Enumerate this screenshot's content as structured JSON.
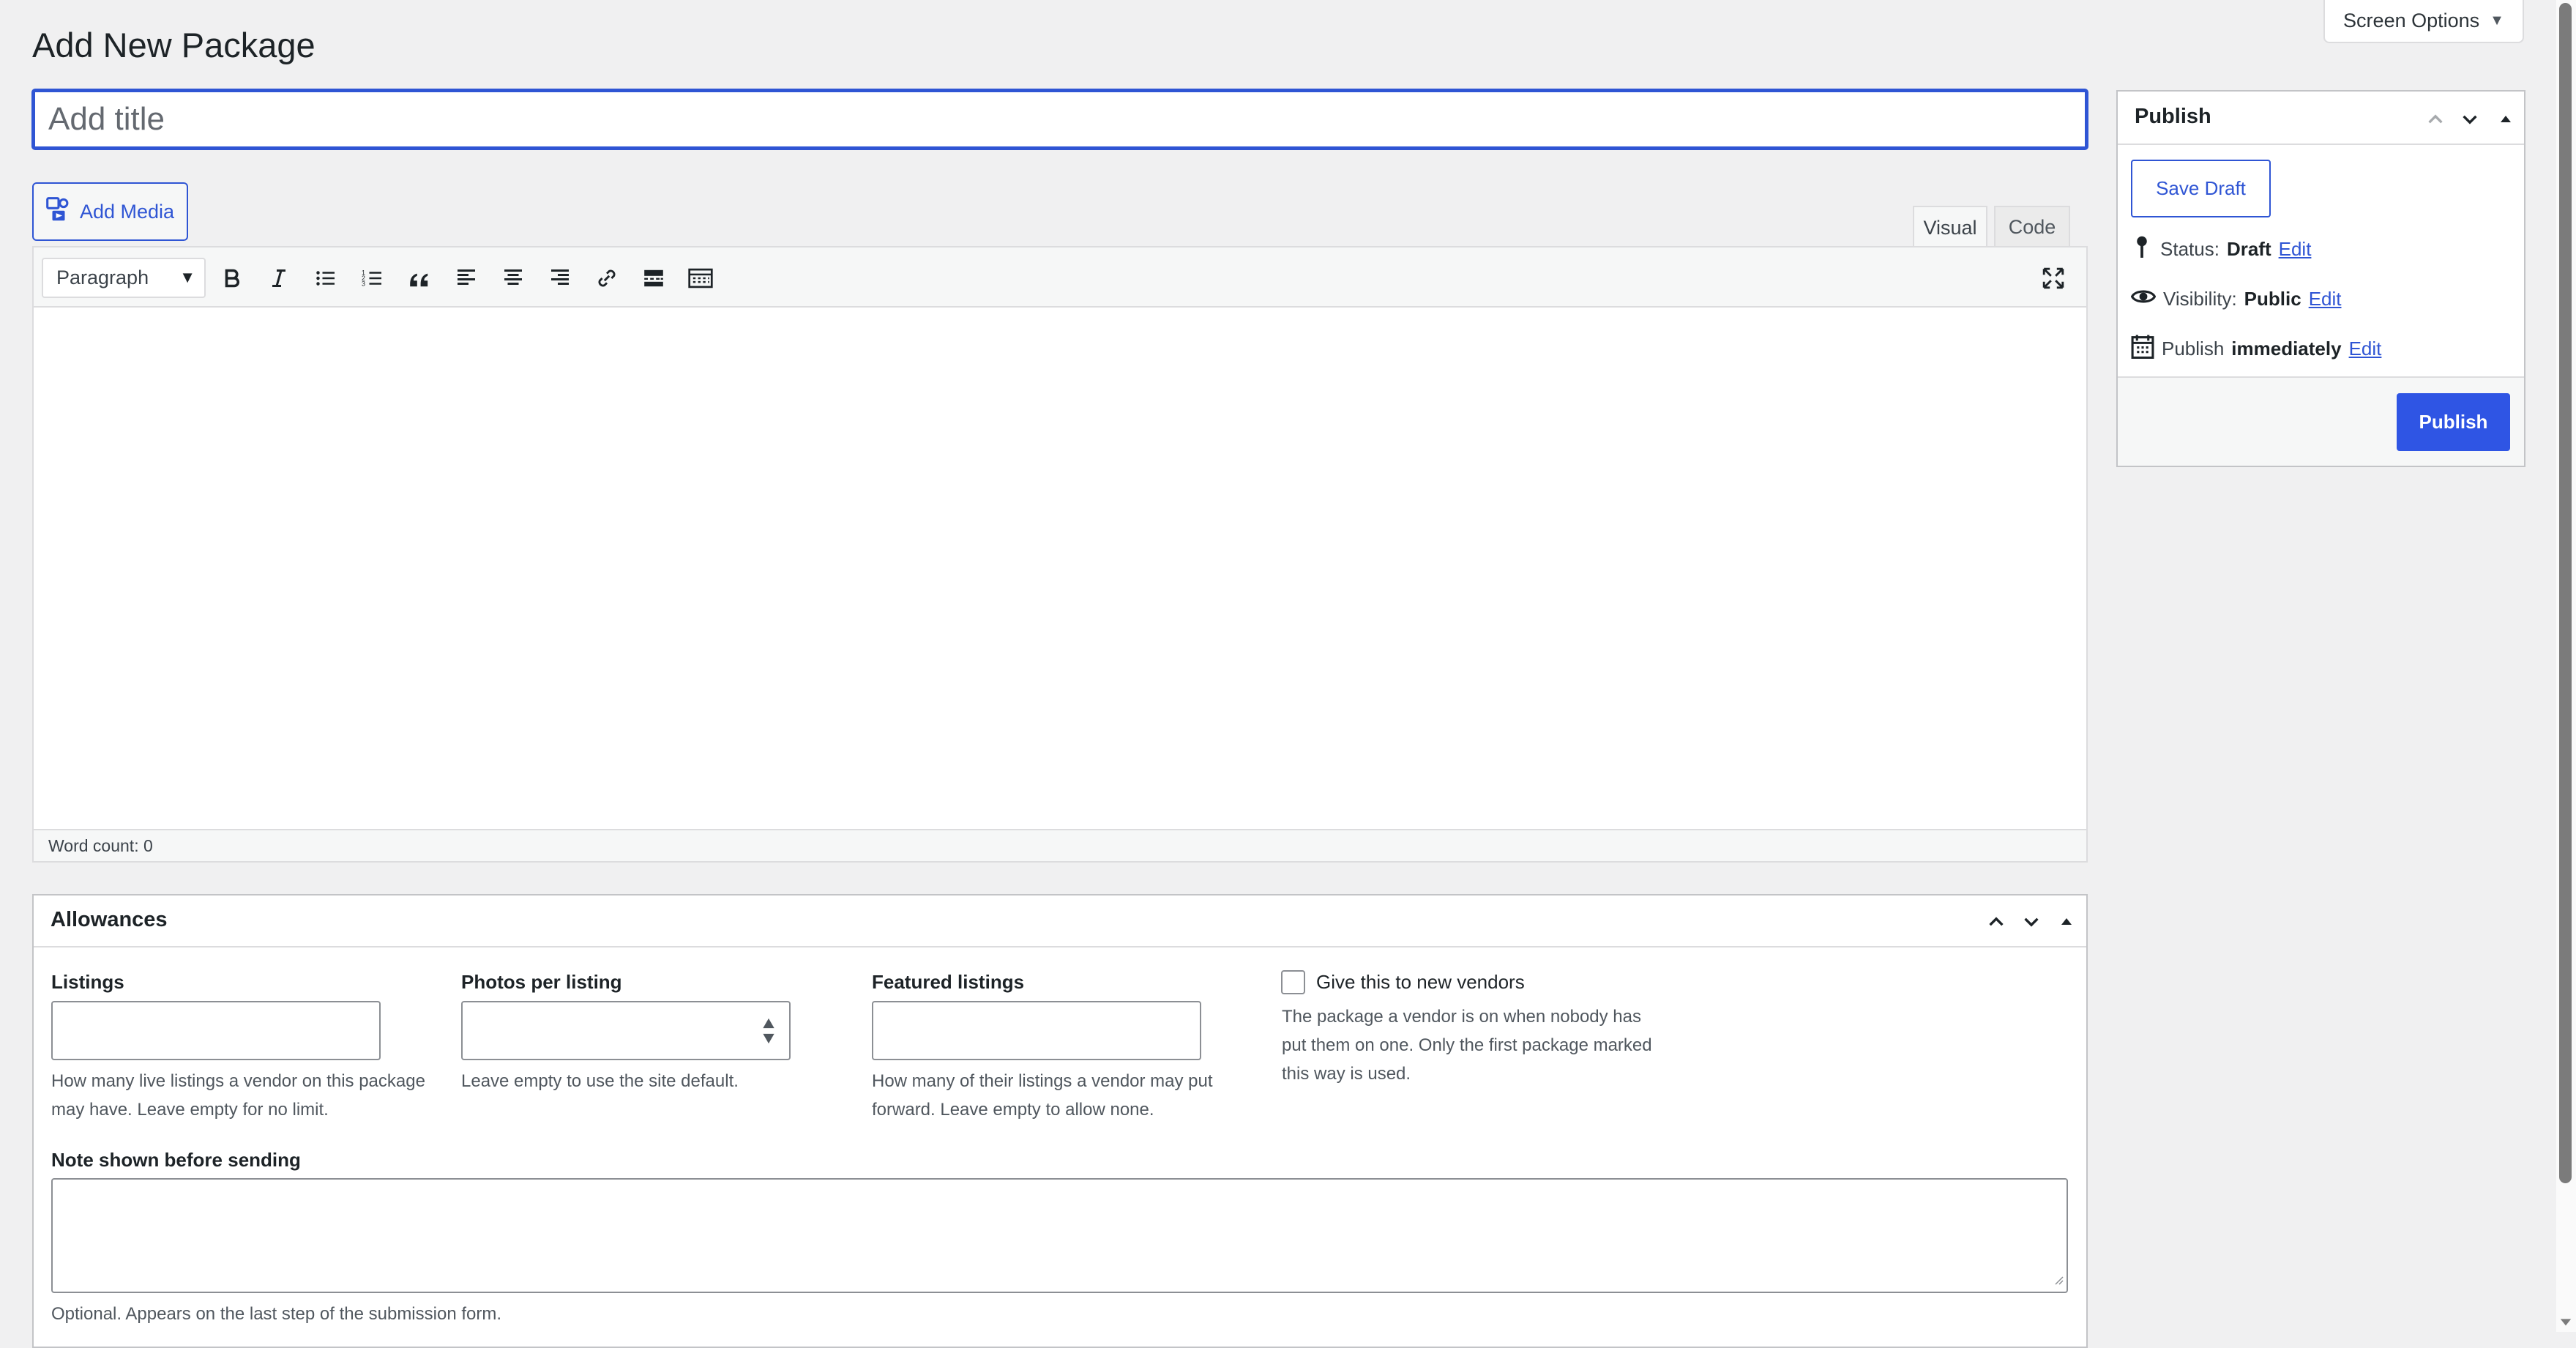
{
  "page": {
    "title": "Add New Package",
    "screen_options_label": "Screen Options"
  },
  "title_field": {
    "placeholder": "Add title",
    "value": ""
  },
  "editor": {
    "add_media_label": "Add Media",
    "tabs": [
      {
        "label": "Visual",
        "active": true
      },
      {
        "label": "Code",
        "active": false
      }
    ],
    "format_select": "Paragraph",
    "toolbar_icons": [
      "bold-icon",
      "italic-icon",
      "bulleted-list-icon",
      "numbered-list-icon",
      "blockquote-icon",
      "align-left-icon",
      "align-center-icon",
      "align-right-icon",
      "link-icon",
      "read-more-icon",
      "toolbar-toggle-icon",
      "fullscreen-icon"
    ],
    "word_count_label": "Word count: 0"
  },
  "publish": {
    "title": "Publish",
    "save_draft_label": "Save Draft",
    "status_label": "Status:",
    "status_value": "Draft",
    "visibility_label": "Visibility:",
    "visibility_value": "Public",
    "schedule_label": "Publish",
    "schedule_value": "immediately",
    "edit_link": "Edit",
    "publish_button": "Publish",
    "accent_color": "#2f55e4"
  },
  "allowances": {
    "title": "Allowances",
    "listings_label": "Listings",
    "listings_value": "",
    "listings_help": "How many live listings a vendor on this package may have. Leave empty for no limit.",
    "photos_label": "Photos per listing",
    "photos_value": "",
    "photos_help": "Leave empty to use the site default.",
    "featured_label": "Featured listings",
    "featured_value": "",
    "featured_help": "How many of their listings a vendor may put forward. Leave empty to allow none.",
    "new_vendor_label": "Give this to new vendors",
    "new_vendor_checked": false,
    "new_vendor_help": "The package a vendor is on when nobody has put them on one. Only the first package marked this way is used.",
    "note_label": "Note shown before sending",
    "note_value": "",
    "note_help": "Optional. Appears on the last step of the submission form."
  }
}
